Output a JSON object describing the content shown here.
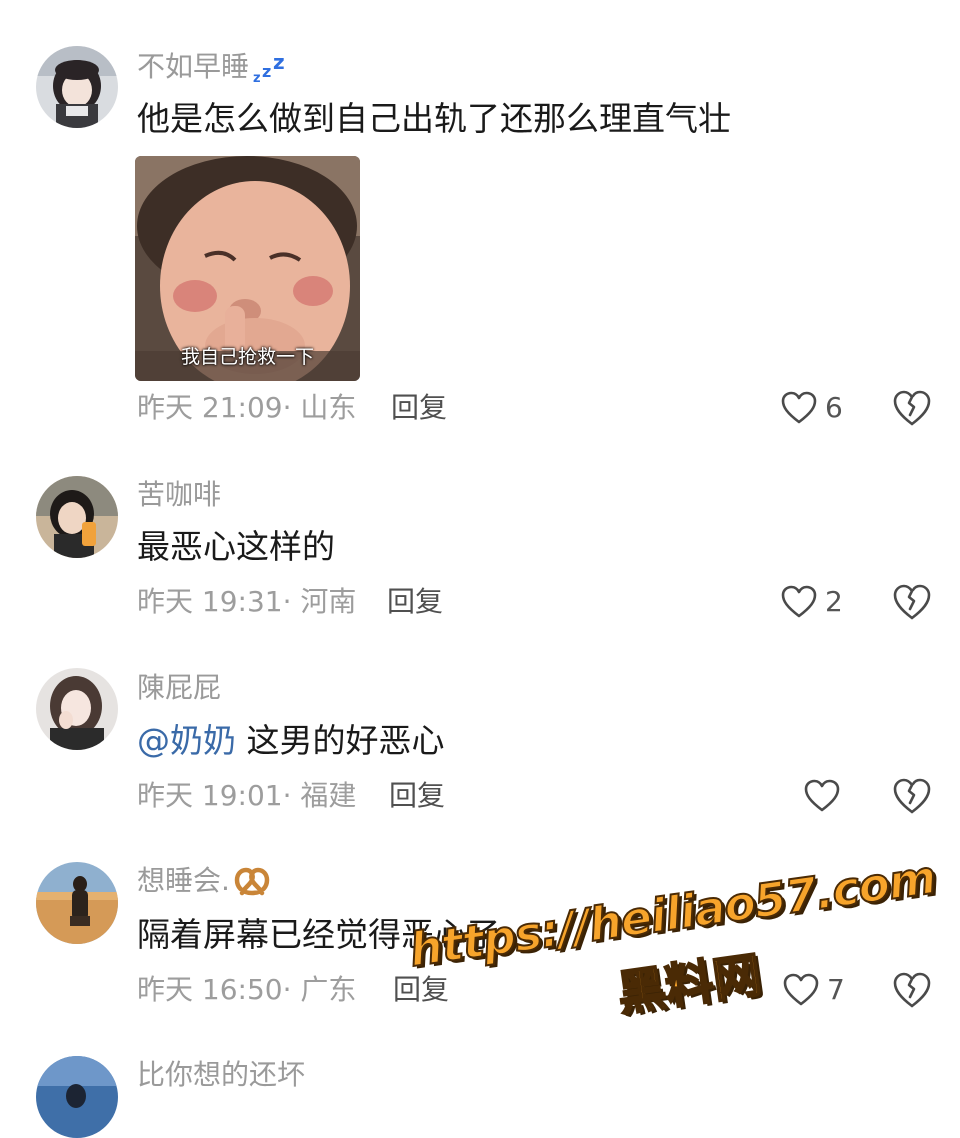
{
  "comments": [
    {
      "username": "不如早睡",
      "username_badge": "zzz-sleep-icon",
      "text": "他是怎么做到自己出轨了还那么理直气壮",
      "sticker": {
        "caption": "我自己抢救一下"
      },
      "time": "昨天 21:09",
      "location": "山东",
      "reply_label": "回复",
      "likes": "6"
    },
    {
      "username": "苦咖啡",
      "text": "最恶心这样的",
      "time": "昨天 19:31",
      "location": "河南",
      "reply_label": "回复",
      "likes": "2"
    },
    {
      "username": "陳屁屁",
      "mention": "@奶奶",
      "text": " 这男的好恶心",
      "time": "昨天 19:01",
      "location": "福建",
      "reply_label": "回复",
      "likes": ""
    },
    {
      "username": "想睡会.",
      "username_badge": "pretzel-icon",
      "text": "隔着屏幕已经觉得恶心了",
      "time": "昨天 16:50",
      "location": "广东",
      "reply_label": "回复",
      "likes": "7"
    },
    {
      "username": "比你想的还坏"
    }
  ],
  "meta_separator": "· ",
  "watermark": {
    "url": "https://heiliao57.com",
    "site": "黑料网"
  },
  "colors": {
    "username": "#9a9a9a",
    "text": "#1a1a1a",
    "mention": "#3a6aa8",
    "meta": "#9d9d9d",
    "icon": "#4a4a4a",
    "watermark_fill": "#f7a42b",
    "badge_blue": "#2f6fe0"
  }
}
